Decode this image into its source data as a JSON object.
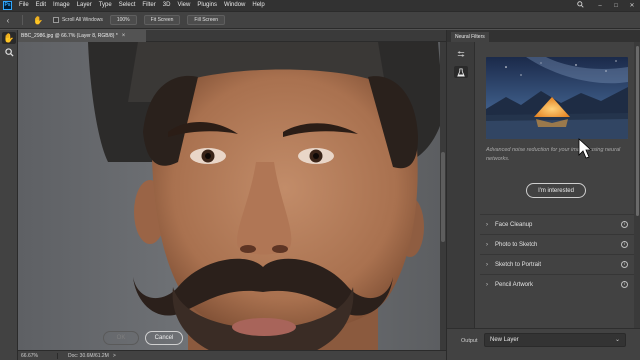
{
  "menubar": {
    "logo": "Ps",
    "items": [
      "File",
      "Edit",
      "Image",
      "Layer",
      "Type",
      "Select",
      "Filter",
      "3D",
      "View",
      "Plugins",
      "Window",
      "Help"
    ],
    "controls": {
      "search_icon": "search-icon",
      "minimize": "–",
      "maximize": "□",
      "close": "✕"
    }
  },
  "options_bar": {
    "scroll_all_windows": "Scroll All Windows",
    "buttons": [
      "100%",
      "Fit Screen",
      "Fill Screen"
    ]
  },
  "document": {
    "tab_title": "BBC_2986.jpg @ 66.7% (Layer 8, RGB/8) *",
    "tab_close": "×"
  },
  "status_bar": {
    "zoom": "66.67%",
    "doc_info": "Doc: 30.6M/61.2M",
    "arrow": ">"
  },
  "panel": {
    "tab": "Neural Filters",
    "description": "Advanced noise reduction for your images using neural networks.",
    "interest_button": "I'm interested",
    "filters": [
      {
        "label": "Face Cleanup"
      },
      {
        "label": "Photo to Sketch"
      },
      {
        "label": "Sketch to Portrait"
      },
      {
        "label": "Pencil Artwork"
      }
    ],
    "output_label": "Output",
    "output_value": "New Layer",
    "ok": "OK",
    "cancel": "Cancel"
  },
  "colors": {
    "app_bg": "#535353",
    "panel_bg": "#424242",
    "menubar_bg": "#323232",
    "skin": "#b27c5b",
    "hat": "#2c2b2a",
    "tent": "#f0a43a"
  }
}
